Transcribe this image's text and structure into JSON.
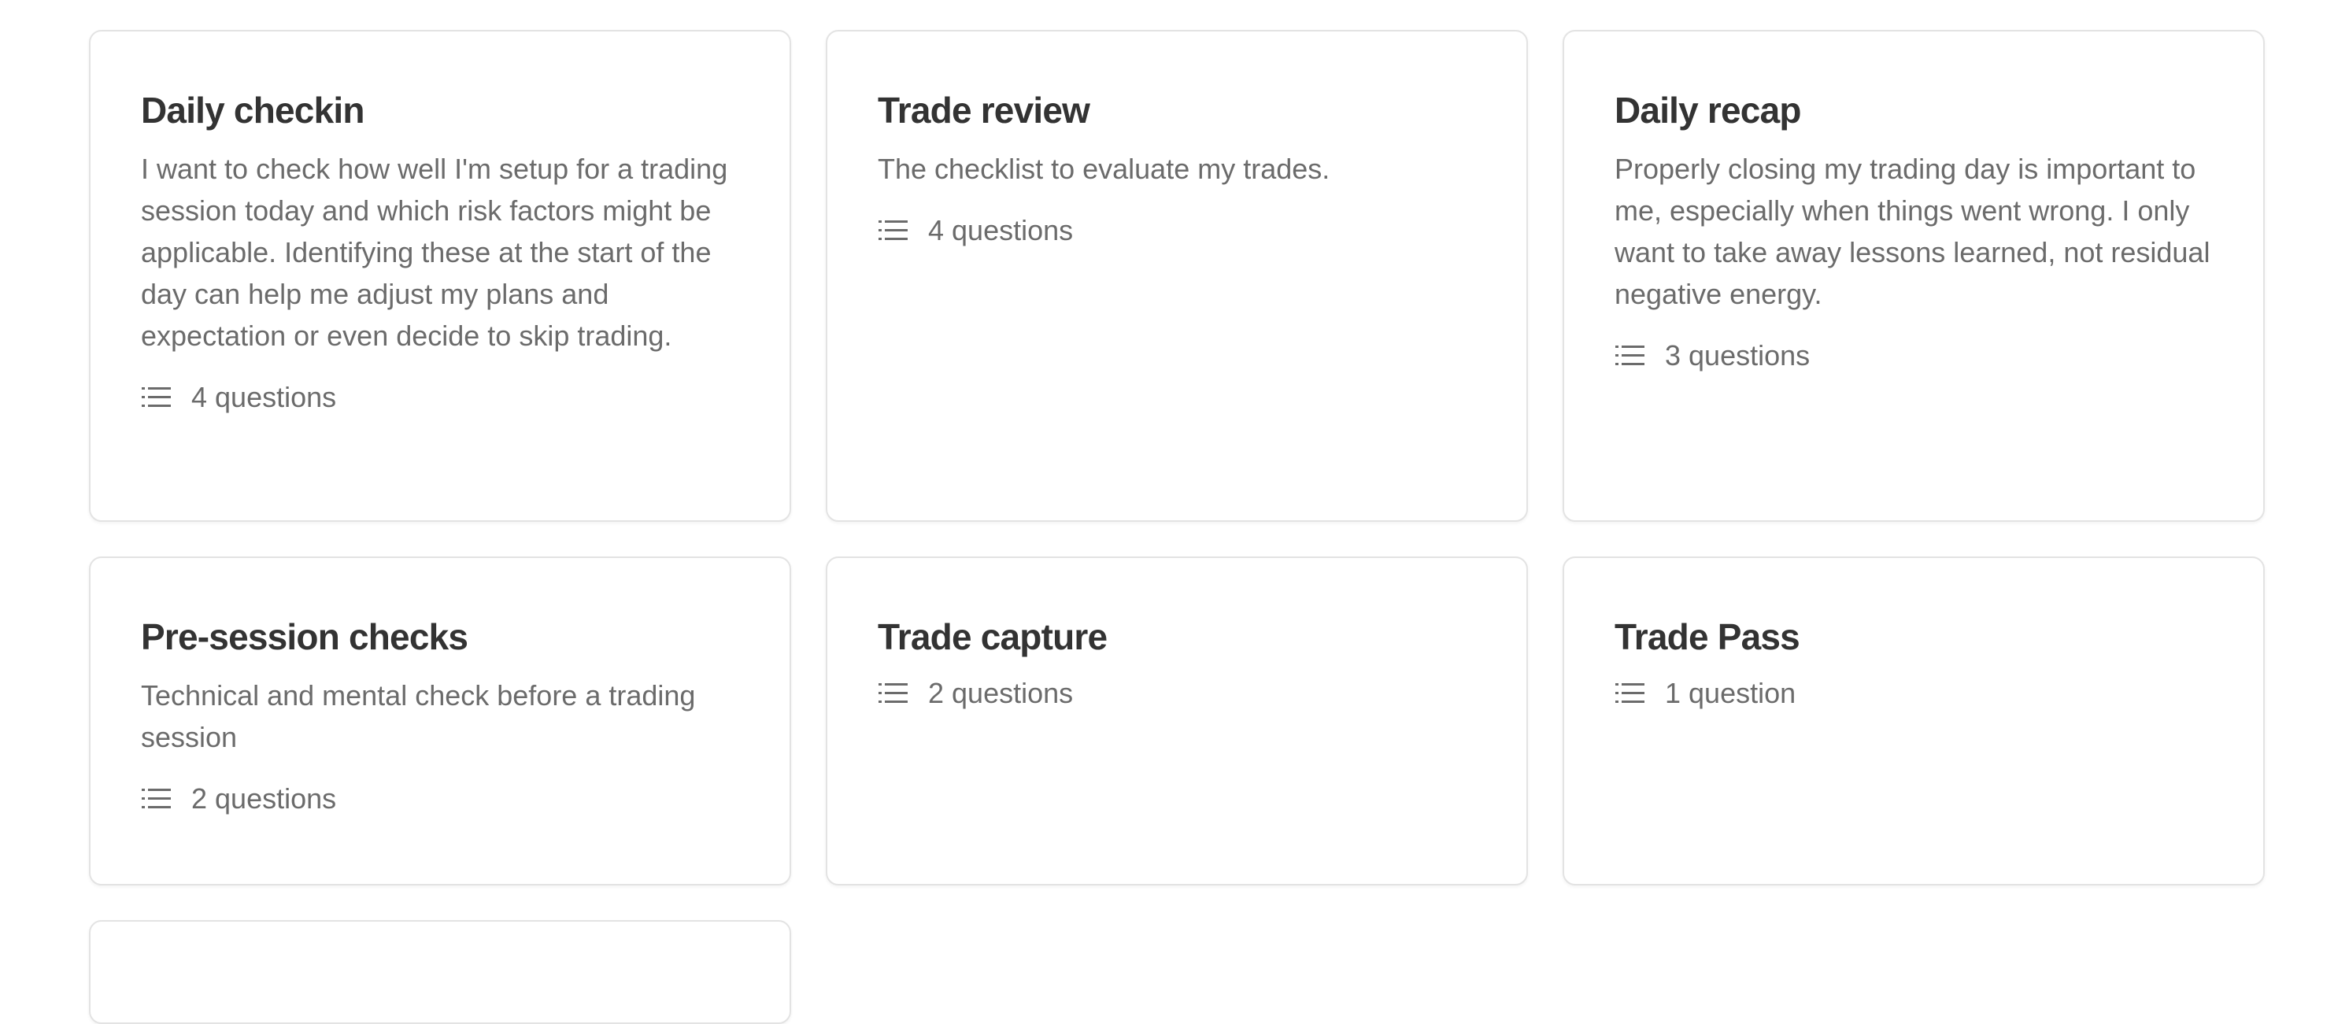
{
  "templates": [
    {
      "title": "Daily checkin",
      "description": "I want to check how well I'm setup for a trading session today and which risk factors might be applicable. Identifying these at the start of the day can help me adjust my plans and expectation or even decide to skip trading.",
      "question_count": "4 questions",
      "icon": "list-icon"
    },
    {
      "title": "Trade review",
      "description": "The checklist to evaluate my trades.",
      "question_count": "4 questions",
      "icon": "list-icon"
    },
    {
      "title": "Daily recap",
      "description": "Properly closing my trading day is important to me, especially when things went wrong. I only want to take away lessons learned, not residual negative energy.",
      "question_count": "3 questions",
      "icon": "list-icon"
    },
    {
      "title": "Pre-session checks",
      "description": "Technical and mental check before a trading session",
      "question_count": "2 questions",
      "icon": "list-icon"
    },
    {
      "title": "Trade capture",
      "description": "",
      "question_count": "2 questions",
      "icon": "list-icon"
    },
    {
      "title": "Trade Pass",
      "description": "",
      "question_count": "1 question",
      "icon": "list-icon"
    }
  ],
  "colors": {
    "title": "#333333",
    "text": "#6b6b6b",
    "border": "#e3e3e3",
    "background": "#ffffff"
  }
}
